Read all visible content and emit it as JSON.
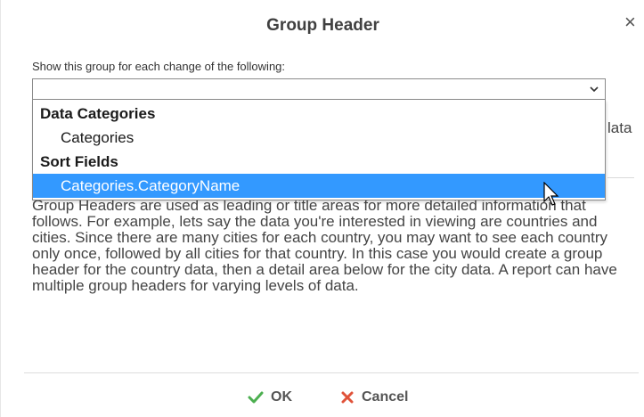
{
  "dialog": {
    "title": "Group Header",
    "close_symbol": "×"
  },
  "prompt": "Show this group for each change of the following:",
  "select": {
    "value": "",
    "icon": "chevron-down-icon"
  },
  "dropdown": {
    "groups": [
      {
        "label": "Data Categories",
        "options": [
          "Categories"
        ]
      },
      {
        "label": "Sort Fields",
        "options": [
          "Categories.CategoryName"
        ]
      }
    ],
    "highlighted": "Categories.CategoryName",
    "highlight_color": "#3399ff"
  },
  "behind_text": "lata",
  "description": "Group Headers are used as leading or title areas for more detailed information that follows. For example, lets say the data you're interested in viewing are countries and cities. Since there are many cities for each country, you may want to see each country only once, followed by all cities for that country. In this case you would create a group header for the country data, then a detail area below for the city data. A report can have multiple group headers for varying levels of data.",
  "buttons": {
    "ok_label": "OK",
    "cancel_label": "Cancel",
    "ok_icon": "check-icon",
    "cancel_icon": "x-icon",
    "ok_color": "#4caf50",
    "cancel_color": "#e0533a"
  }
}
